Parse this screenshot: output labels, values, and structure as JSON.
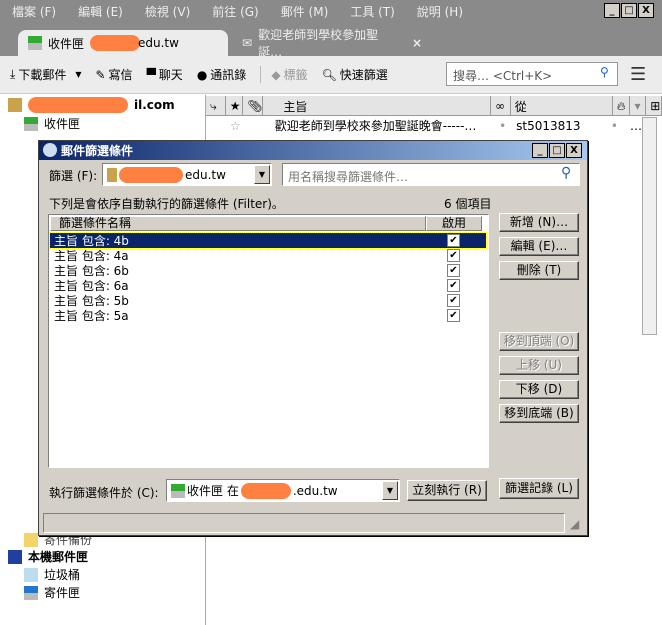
{
  "menu": [
    "檔案 (F)",
    "編輯 (E)",
    "檢視 (V)",
    "前往 (G)",
    "郵件 (M)",
    "工具 (T)",
    "說明 (H)"
  ],
  "window_controls": [
    "_",
    "□",
    "X"
  ],
  "tabs": [
    {
      "label": "收件匣",
      "suffix": "edu.tw",
      "icon": "inbox-icon"
    },
    {
      "label": "歡迎老師到學校參加聖誕…",
      "icon": "envelope-icon",
      "close": "×"
    }
  ],
  "toolbar": {
    "get_mail": "下載郵件",
    "write": "寫信",
    "chat": "聊天",
    "address_book": "通訊錄",
    "tag": "標籤",
    "quick_filter": "快速篩選",
    "search_placeholder": "搜尋… <Ctrl+K>"
  },
  "folders": {
    "account_suffix": "il.com",
    "inbox": "收件匣",
    "sent_partial": "寄件備份",
    "local": "本機郵件匣",
    "trash": "垃圾桶",
    "outbox": "寄件匣"
  },
  "message_list": {
    "columns": [
      "主旨",
      "從"
    ],
    "rows": [
      {
        "subject": "歡迎老師到學校來參加聖誕晚會-----…",
        "from": "st5013813",
        "dots": "…"
      }
    ]
  },
  "dialog": {
    "title": "郵件篩選條件",
    "filter_label": "篩選 (F):",
    "account_suffix": "edu.tw",
    "search_placeholder": "用名稱搜尋篩選條件…",
    "description": "下列是會依序自動執行的篩選條件 (Filter)。",
    "count": "6 個項目",
    "col_name": "篩選條件名稱",
    "col_enabled": "啟用",
    "filters": [
      {
        "name": "主旨 包含: 4b",
        "enabled": true,
        "selected": true
      },
      {
        "name": "主旨 包含: 4a",
        "enabled": true
      },
      {
        "name": "主旨 包含: 6b",
        "enabled": true
      },
      {
        "name": "主旨 包含: 6a",
        "enabled": true
      },
      {
        "name": "主旨 包含: 5b",
        "enabled": true
      },
      {
        "name": "主旨 包含: 5a",
        "enabled": true
      }
    ],
    "buttons": {
      "new": "新增 (N)…",
      "edit": "編輯 (E)…",
      "delete": "刪除 (T)",
      "top": "移到頂端 (O)",
      "up": "上移 (U)",
      "down": "下移 (D)",
      "bottom": "移到底端 (B)",
      "run_now": "立刻執行 (R)",
      "log": "篩選記錄 (L)"
    },
    "run_label": "執行篩選條件於 (C):",
    "run_folder": "收件匣 在",
    "run_suffix": ".edu.tw"
  },
  "colors": {
    "selection": "#0a246a",
    "dialog_bg": "#d4d0c8",
    "redaction": "#ff8040"
  }
}
